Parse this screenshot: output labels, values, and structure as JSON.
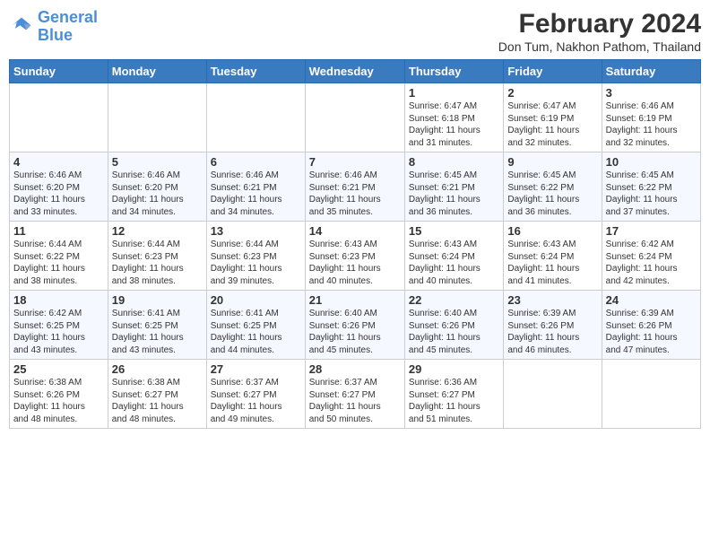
{
  "logo": {
    "line1": "General",
    "line2": "Blue"
  },
  "title": "February 2024",
  "location": "Don Tum, Nakhon Pathom, Thailand",
  "days_of_week": [
    "Sunday",
    "Monday",
    "Tuesday",
    "Wednesday",
    "Thursday",
    "Friday",
    "Saturday"
  ],
  "weeks": [
    [
      {
        "day": "",
        "info": ""
      },
      {
        "day": "",
        "info": ""
      },
      {
        "day": "",
        "info": ""
      },
      {
        "day": "",
        "info": ""
      },
      {
        "day": "1",
        "info": "Sunrise: 6:47 AM\nSunset: 6:18 PM\nDaylight: 11 hours\nand 31 minutes."
      },
      {
        "day": "2",
        "info": "Sunrise: 6:47 AM\nSunset: 6:19 PM\nDaylight: 11 hours\nand 32 minutes."
      },
      {
        "day": "3",
        "info": "Sunrise: 6:46 AM\nSunset: 6:19 PM\nDaylight: 11 hours\nand 32 minutes."
      }
    ],
    [
      {
        "day": "4",
        "info": "Sunrise: 6:46 AM\nSunset: 6:20 PM\nDaylight: 11 hours\nand 33 minutes."
      },
      {
        "day": "5",
        "info": "Sunrise: 6:46 AM\nSunset: 6:20 PM\nDaylight: 11 hours\nand 34 minutes."
      },
      {
        "day": "6",
        "info": "Sunrise: 6:46 AM\nSunset: 6:21 PM\nDaylight: 11 hours\nand 34 minutes."
      },
      {
        "day": "7",
        "info": "Sunrise: 6:46 AM\nSunset: 6:21 PM\nDaylight: 11 hours\nand 35 minutes."
      },
      {
        "day": "8",
        "info": "Sunrise: 6:45 AM\nSunset: 6:21 PM\nDaylight: 11 hours\nand 36 minutes."
      },
      {
        "day": "9",
        "info": "Sunrise: 6:45 AM\nSunset: 6:22 PM\nDaylight: 11 hours\nand 36 minutes."
      },
      {
        "day": "10",
        "info": "Sunrise: 6:45 AM\nSunset: 6:22 PM\nDaylight: 11 hours\nand 37 minutes."
      }
    ],
    [
      {
        "day": "11",
        "info": "Sunrise: 6:44 AM\nSunset: 6:22 PM\nDaylight: 11 hours\nand 38 minutes."
      },
      {
        "day": "12",
        "info": "Sunrise: 6:44 AM\nSunset: 6:23 PM\nDaylight: 11 hours\nand 38 minutes."
      },
      {
        "day": "13",
        "info": "Sunrise: 6:44 AM\nSunset: 6:23 PM\nDaylight: 11 hours\nand 39 minutes."
      },
      {
        "day": "14",
        "info": "Sunrise: 6:43 AM\nSunset: 6:23 PM\nDaylight: 11 hours\nand 40 minutes."
      },
      {
        "day": "15",
        "info": "Sunrise: 6:43 AM\nSunset: 6:24 PM\nDaylight: 11 hours\nand 40 minutes."
      },
      {
        "day": "16",
        "info": "Sunrise: 6:43 AM\nSunset: 6:24 PM\nDaylight: 11 hours\nand 41 minutes."
      },
      {
        "day": "17",
        "info": "Sunrise: 6:42 AM\nSunset: 6:24 PM\nDaylight: 11 hours\nand 42 minutes."
      }
    ],
    [
      {
        "day": "18",
        "info": "Sunrise: 6:42 AM\nSunset: 6:25 PM\nDaylight: 11 hours\nand 43 minutes."
      },
      {
        "day": "19",
        "info": "Sunrise: 6:41 AM\nSunset: 6:25 PM\nDaylight: 11 hours\nand 43 minutes."
      },
      {
        "day": "20",
        "info": "Sunrise: 6:41 AM\nSunset: 6:25 PM\nDaylight: 11 hours\nand 44 minutes."
      },
      {
        "day": "21",
        "info": "Sunrise: 6:40 AM\nSunset: 6:26 PM\nDaylight: 11 hours\nand 45 minutes."
      },
      {
        "day": "22",
        "info": "Sunrise: 6:40 AM\nSunset: 6:26 PM\nDaylight: 11 hours\nand 45 minutes."
      },
      {
        "day": "23",
        "info": "Sunrise: 6:39 AM\nSunset: 6:26 PM\nDaylight: 11 hours\nand 46 minutes."
      },
      {
        "day": "24",
        "info": "Sunrise: 6:39 AM\nSunset: 6:26 PM\nDaylight: 11 hours\nand 47 minutes."
      }
    ],
    [
      {
        "day": "25",
        "info": "Sunrise: 6:38 AM\nSunset: 6:26 PM\nDaylight: 11 hours\nand 48 minutes."
      },
      {
        "day": "26",
        "info": "Sunrise: 6:38 AM\nSunset: 6:27 PM\nDaylight: 11 hours\nand 48 minutes."
      },
      {
        "day": "27",
        "info": "Sunrise: 6:37 AM\nSunset: 6:27 PM\nDaylight: 11 hours\nand 49 minutes."
      },
      {
        "day": "28",
        "info": "Sunrise: 6:37 AM\nSunset: 6:27 PM\nDaylight: 11 hours\nand 50 minutes."
      },
      {
        "day": "29",
        "info": "Sunrise: 6:36 AM\nSunset: 6:27 PM\nDaylight: 11 hours\nand 51 minutes."
      },
      {
        "day": "",
        "info": ""
      },
      {
        "day": "",
        "info": ""
      }
    ]
  ]
}
